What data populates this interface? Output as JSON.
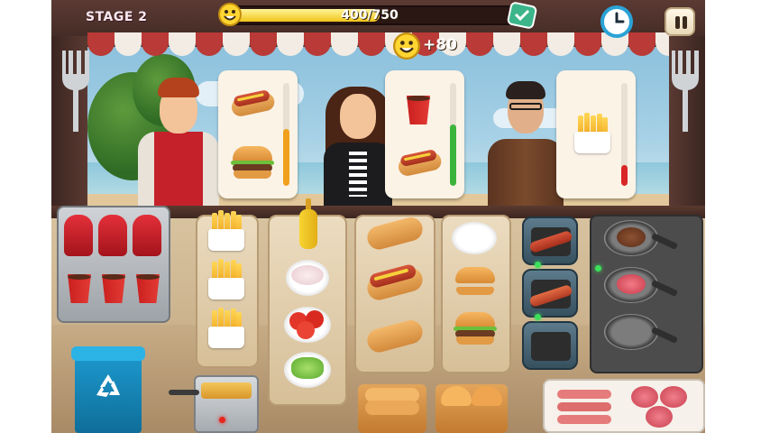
{
  "hud": {
    "stage_label": "STAGE 2",
    "progress_text": "400/750",
    "progress_value": 400,
    "progress_goal": 750,
    "coin_bonus": "+80",
    "icons": [
      "smiley-icon",
      "goal-badge-icon",
      "clock-icon",
      "pause-icon"
    ]
  },
  "customers": [
    {
      "name": "customer-red-jacket",
      "order": [
        "hotdog",
        "burger"
      ],
      "patience_fraction": 0.55,
      "patience_color": "#f0a01c"
    },
    {
      "name": "customer-black-jacket",
      "order": [
        "soda",
        "hotdog"
      ],
      "patience_fraction": 0.6,
      "patience_color": "#3cb43c"
    },
    {
      "name": "customer-glasses",
      "order": [
        "fries"
      ],
      "patience_fraction": 0.2,
      "patience_color": "#d92626"
    }
  ],
  "stations": [
    "soda-machine",
    "fries-column",
    "condiment-column",
    "hotdog-column",
    "burger-column",
    "sausage-grills",
    "patty-stove",
    "trash-bin",
    "fryer",
    "bun-baskets",
    "raw-meat-tray"
  ],
  "colors": {
    "accent": "#f0c419",
    "truck_frame": "#4a2f29",
    "counter": "#d1b993",
    "awning_red": "#b93a36"
  }
}
